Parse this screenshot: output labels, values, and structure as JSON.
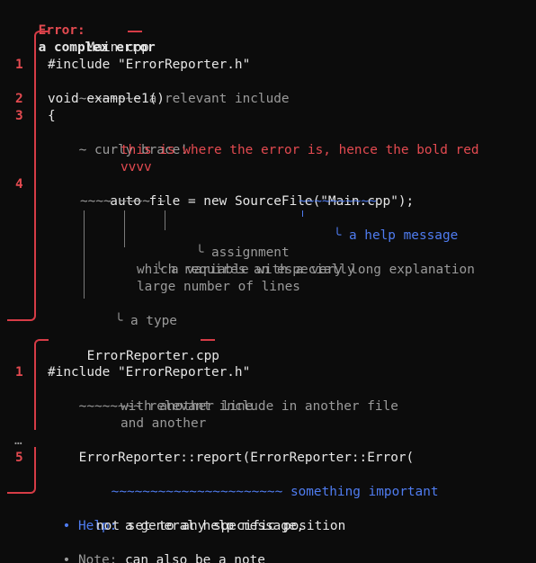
{
  "header": {
    "label": "Error:",
    "message": "a complex error"
  },
  "blocks": [
    {
      "file": "Main.cpp",
      "lines": [
        {
          "num": "1",
          "code": "#include \"ErrorReporter.h\"",
          "squiggle": "~~~~~~~~",
          "note": "a relevant include"
        },
        {
          "num": "2",
          "code": "void example1()"
        },
        {
          "num": "3",
          "code": "{",
          "squiggle": "~",
          "note": "curly brace!"
        },
        {
          "error_note_1": "this is where the error is, hence the bold red",
          "error_note_2": "vvvv"
        },
        {
          "num": "4",
          "code_pre": "    auto file = new ",
          "code_main": "SourceFile(\"Main.cpp\");"
        }
      ],
      "annotations": {
        "squiggles": "~~~~ ~~~~ ~",
        "blue_squiggle": "~~~~~~~~~~",
        "help": "a help message",
        "assignment": "assignment",
        "variable_1": "a variable with a very long explanation",
        "variable_2": "which requires an especially",
        "variable_3": "large number of lines",
        "type": "a type"
      }
    },
    {
      "file": "ErrorReporter.cpp",
      "lines": [
        {
          "num": "1",
          "code": "#include \"ErrorReporter.h\"",
          "squiggle": "~~~~~~~~",
          "note_1": "relevant include in another file",
          "note_2": "with another line",
          "note_3": "and another"
        },
        {
          "ellipsis": "…"
        },
        {
          "num": "5",
          "code": "    ErrorReporter::report(ErrorReporter::Error(",
          "squiggle": "~~~~~~~~~~~~~~~~~~~~~~",
          "note": "something important"
        }
      ]
    }
  ],
  "footer": {
    "bullet": "•",
    "help_label": "Help:",
    "help_1": "a general help message,",
    "help_2": "not set to any specific position",
    "note_label": "Note:",
    "note_1": "can also be a note"
  },
  "colors": {
    "red": "#e34a50",
    "blue": "#4f7cf0",
    "grey": "#9a9a9a",
    "text": "#e6e6e6",
    "background": "#0c0c0c"
  }
}
